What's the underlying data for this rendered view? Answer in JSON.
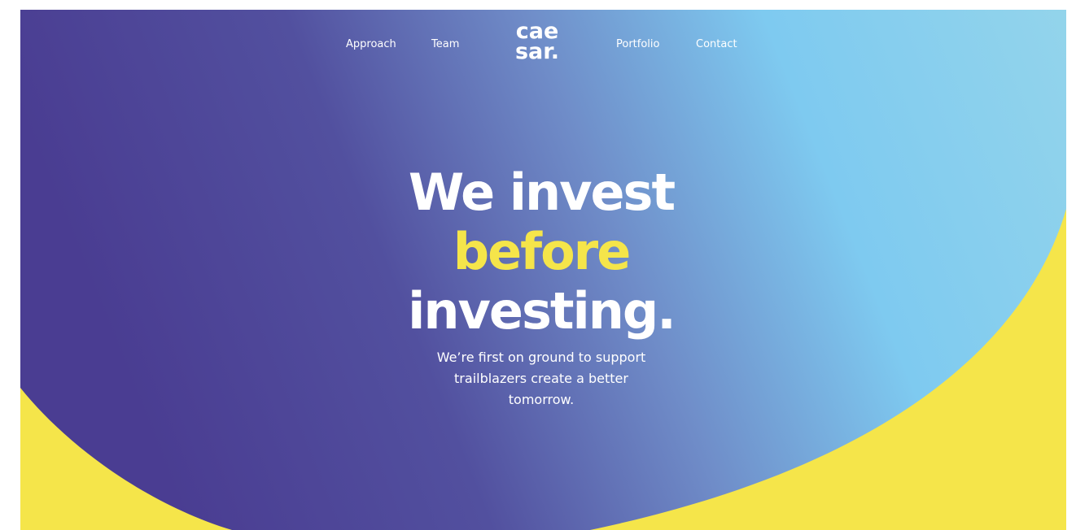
{
  "colors": {
    "deep_purple": "#4a3d92",
    "mid_blue": "#6f8cc8",
    "sky_blue": "#7ecaf0",
    "accent_yellow": "#f5e54a",
    "text_white": "#ffffff"
  },
  "nav": {
    "items": [
      {
        "label": "Approach"
      },
      {
        "label": "Team"
      },
      {
        "label": "Portfolio"
      },
      {
        "label": "Contact"
      }
    ]
  },
  "logo": {
    "line1": "cae",
    "line2": "sar."
  },
  "hero": {
    "headline_line1": "We invest",
    "headline_line2": "before",
    "headline_line3": "investing.",
    "subtext_line1": "We’re first on ground to support",
    "subtext_line2": "trailblazers create a better",
    "subtext_line3": "tomorrow."
  }
}
